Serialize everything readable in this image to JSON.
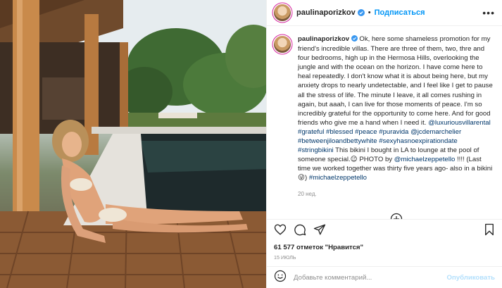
{
  "post": {
    "username": "paulinaporizkov",
    "follow_label": "Подписаться",
    "caption_user": "paulinaporizkov",
    "caption_part1": "Ok, here some shameless promotion for my friend's incredible villas. There are three of them, two, thre and four bedrooms, high up in the Hermosa Hills, overlooking the jungle and with the ocean on the horizon. I have come here to heal repeatedly. I don't know what it is about being here, but my anxiety drops to nearly undetectable, and I feel like I get to pause all the stress of life. The minute I leave, it all comes rushing in again, but aaah, I can live for those moments of peace. I'm so incredibly grateful for the opportunity to come here. And for good friends who give me a hand when I need it.",
    "mention1": "@luxuriousvillarental",
    "tag_grateful": "#grateful",
    "tag_blessed": "#blessed",
    "tag_peace": "#peace",
    "tag_puravida": "#puravida",
    "mention2": "@jcdemarchelier",
    "tag_between": "#betweenjiloandbettywhite",
    "tag_sexy": "#sexyhasnoexpirationdate",
    "tag_string": "#stringbikini",
    "caption_part2": "This bikini I bought in LA to lounge at the pool of someone special.",
    "emoji1": "😉",
    "caption_part3": "PHOTO by",
    "mention3": "@michaelzeppetello",
    "caption_part4": "!!!! (Last time we worked together was thirty five years ago- also in a bikini",
    "emoji2": "😜",
    "caption_part5": ")",
    "tag_michael": "#michaelzeppetello",
    "age": "20 нед.",
    "likes": "61 577 отметок \"Нравится\"",
    "date": "15 июль",
    "comment_placeholder": "Добавьте комментарий...",
    "publish_label": "Опубликовать"
  },
  "icons": {
    "verified": "verified-badge-icon",
    "more": "more-options-icon",
    "load_more": "plus-circle-icon",
    "like": "heart-icon",
    "comment": "speech-bubble-icon",
    "share": "paper-plane-icon",
    "save": "bookmark-icon",
    "emoji": "smiley-icon"
  },
  "colors": {
    "link": "#00376b",
    "follow": "#0095f6",
    "verified": "#3897f0",
    "publish_disabled": "#b2dffc",
    "muted": "#8e8e8e"
  }
}
